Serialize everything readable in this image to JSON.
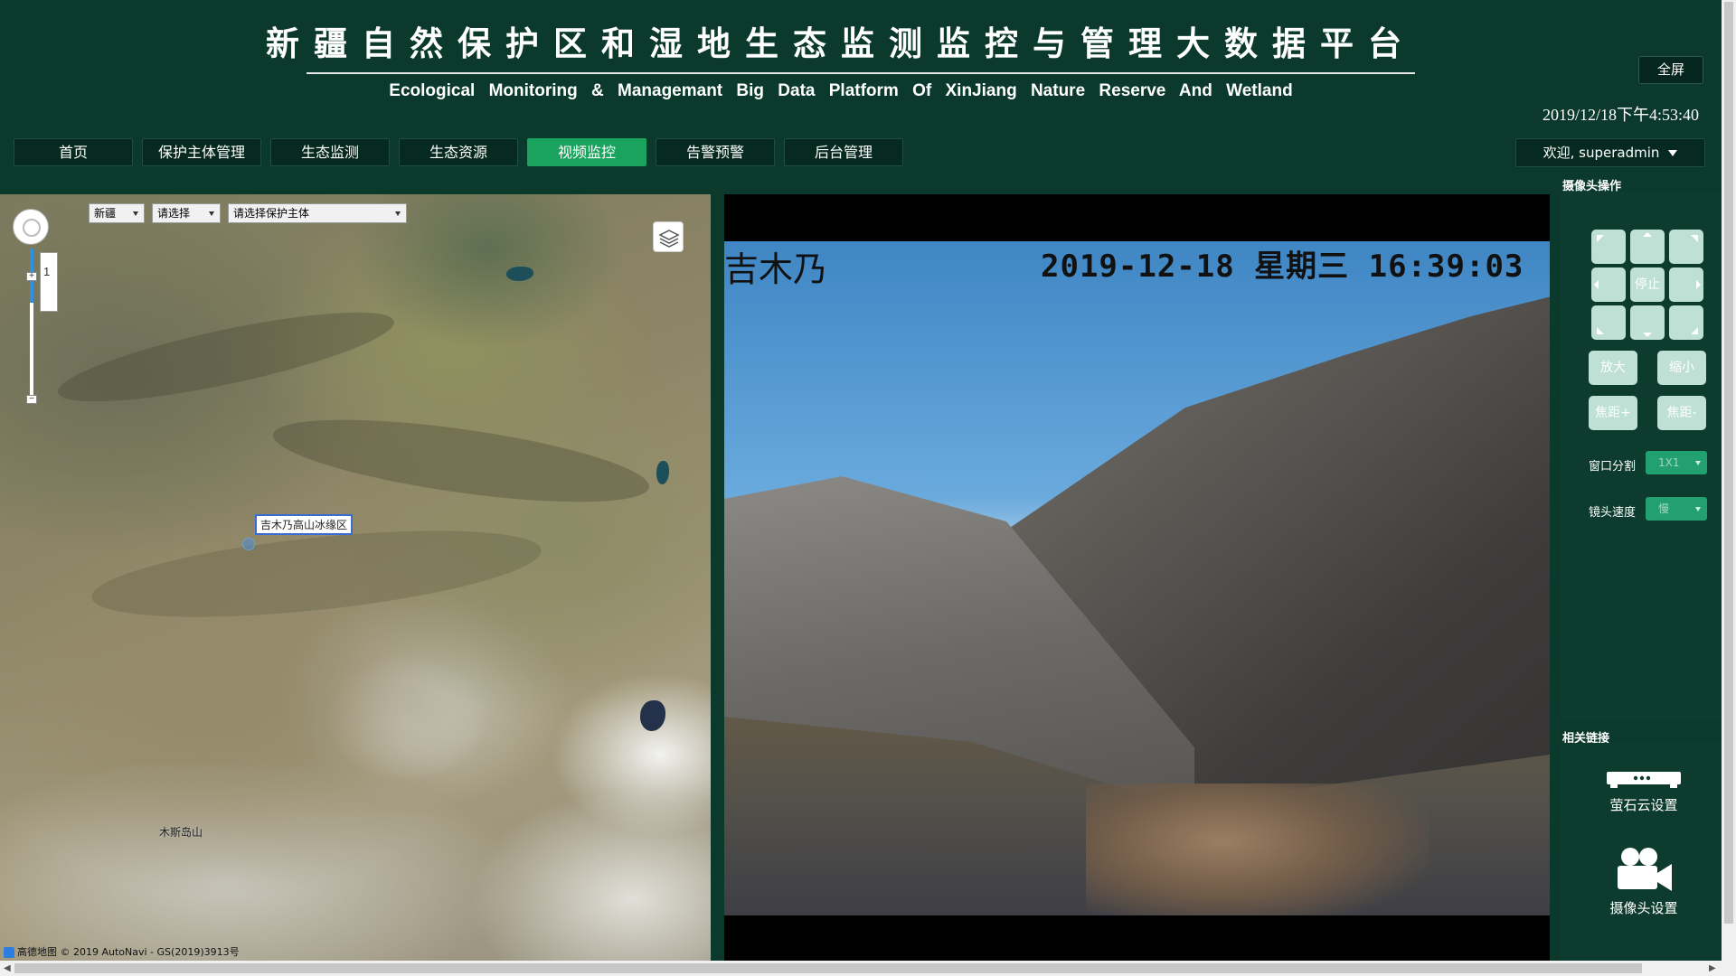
{
  "header": {
    "title_cn": "新疆自然保护区和湿地生态监测监控与管理大数据平台",
    "title_en": "Ecological Monitoring & Managemant Big Data Platform Of XinJiang Nature Reserve And Wetland",
    "fullscreen_label": "全屏",
    "datetime": "2019/12/18下午4:53:40"
  },
  "nav": {
    "items": [
      {
        "label": "首页"
      },
      {
        "label": "保护主体管理"
      },
      {
        "label": "生态监测"
      },
      {
        "label": "生态资源"
      },
      {
        "label": "视频监控",
        "active": true
      },
      {
        "label": "告警预警"
      },
      {
        "label": "后台管理"
      }
    ],
    "user_menu": "欢迎, superadmin"
  },
  "map": {
    "region_select": "新疆",
    "type_select": "请选择",
    "subject_select": "请选择保护主体",
    "scale_label": "1",
    "marker_label": "吉木乃高山冰缘区",
    "place_labels": [
      "木斯岛山"
    ],
    "footer": "高德地图 © 2019 AutoNavi - GS(2019)3913号"
  },
  "video": {
    "osd_location": "吉木乃",
    "osd_datetime": "2019-12-18 星期三 16:39:03"
  },
  "camera_ops": {
    "title": "摄像头操作",
    "stop_label": "停止",
    "zoom_in_label": "放大",
    "zoom_out_label": "缩小",
    "focus_plus_label": "焦距+",
    "focus_minus_label": "焦距-",
    "window_split_label": "窗口分割",
    "window_split_value": "1X1",
    "lens_speed_label": "镜头速度",
    "lens_speed_value": "慢"
  },
  "related_links": {
    "title": "相关链接",
    "items": [
      {
        "label": "萤石云设置",
        "icon": "nvr-device-icon"
      },
      {
        "label": "摄像头设置",
        "icon": "video-camera-icon"
      }
    ]
  },
  "colors": {
    "background": "#0b3a2d",
    "nav_active": "#1aa35c",
    "ptz_button": "#bfe0d5",
    "select_bg": "#23a071"
  }
}
